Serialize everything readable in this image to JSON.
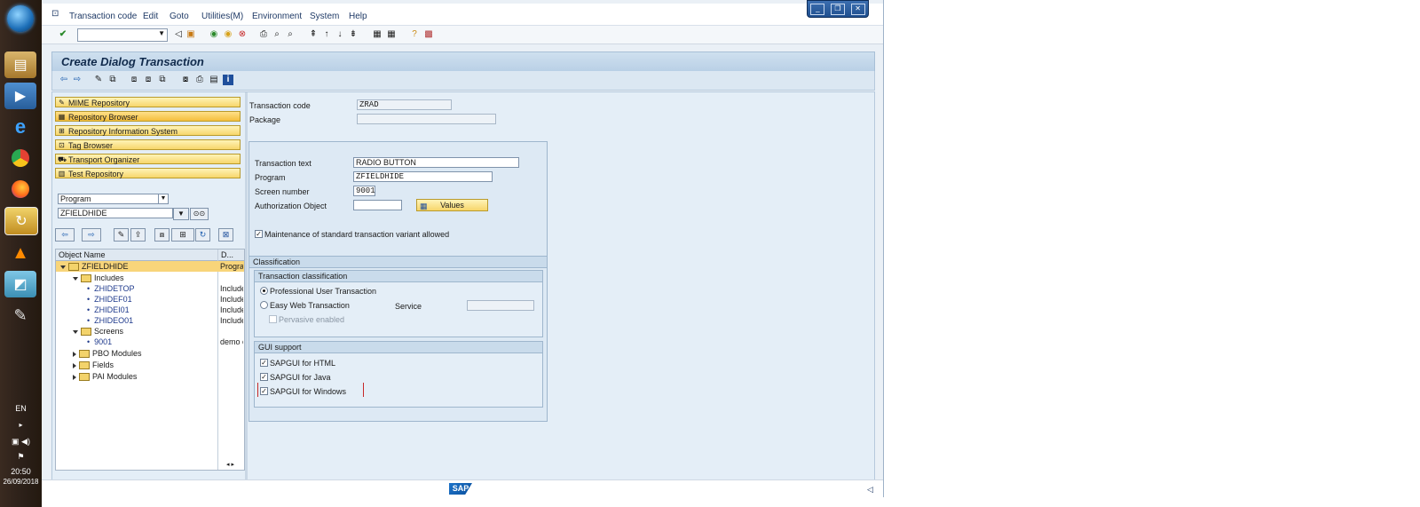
{
  "taskbar": {
    "language": "EN",
    "time": "20:50",
    "date": "26/09/2018"
  },
  "menu": {
    "items": [
      "Transaction code",
      "Edit",
      "Goto",
      "Utilities(M)",
      "Environment",
      "System",
      "Help"
    ]
  },
  "page": {
    "title": "Create Dialog Transaction"
  },
  "nav": {
    "buttons": [
      "MIME Repository",
      "Repository Browser",
      "Repository Information System",
      "Tag Browser",
      "Transport Organizer",
      "Test Repository"
    ],
    "object_type": "Program",
    "object_name": "ZFIELDHIDE"
  },
  "tree": {
    "columns": [
      "Object Name",
      "D..."
    ],
    "rows": [
      {
        "name": "ZFIELDHIDE",
        "desc": "Progra"
      },
      {
        "name": "Includes",
        "desc": ""
      },
      {
        "name": "ZHIDETOP",
        "desc": "Include"
      },
      {
        "name": "ZHIDEF01",
        "desc": "Include"
      },
      {
        "name": "ZHIDEI01",
        "desc": "Include"
      },
      {
        "name": "ZHIDEO01",
        "desc": "Include"
      },
      {
        "name": "Screens",
        "desc": ""
      },
      {
        "name": "9001",
        "desc": "demo c"
      },
      {
        "name": "PBO Modules",
        "desc": ""
      },
      {
        "name": "Fields",
        "desc": ""
      },
      {
        "name": "PAI Modules",
        "desc": ""
      }
    ]
  },
  "form": {
    "tcode_label": "Transaction code",
    "tcode_value": "ZRAD",
    "package_label": "Package",
    "package_value": "",
    "text_label": "Transaction text",
    "text_value": "RADIO BUTTON",
    "program_label": "Program",
    "program_value": "ZFIELDHIDE",
    "screen_label": "Screen number",
    "screen_value": "9001",
    "auth_label": "Authorization Object",
    "auth_value": "",
    "values_button": "Values",
    "variant_label": "Maintenance of standard transaction variant allowed"
  },
  "classification": {
    "header": "Classification",
    "tc_header": "Transaction classification",
    "professional": "Professional User Transaction",
    "easy_web": "Easy Web Transaction",
    "service_label": "Service",
    "pervasive": "Pervasive enabled",
    "gui_header": "GUI support",
    "gui_html": "SAPGUI for HTML",
    "gui_java": "SAPGUI for Java",
    "gui_windows": "SAPGUI for Windows"
  },
  "status": {
    "logo": "SAP"
  }
}
